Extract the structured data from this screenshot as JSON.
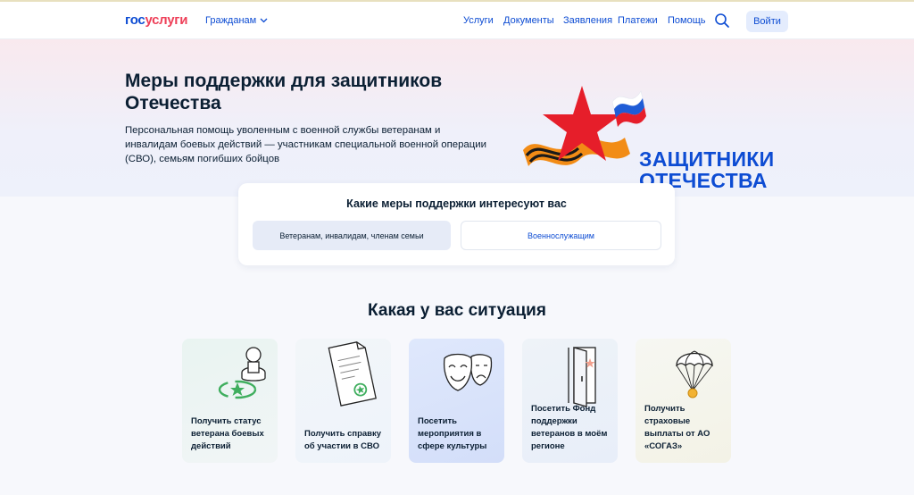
{
  "header": {
    "logo_part1": "гос",
    "logo_part2": "услуги",
    "audience": "Гражданам",
    "nav": [
      "Услуги",
      "Документы",
      "Заявления",
      "Платежи",
      "Помощь"
    ],
    "search_icon": "search-icon",
    "login": "Войти"
  },
  "hero": {
    "title": "Меры поддержки для защитников Отечества",
    "description": "Персональная помощь уволенным с военной службы ветеранам и инвалидам боевых действий — участникам специальной военной операции (СВО), семьям погибших бойцов",
    "logo_line1": "ЗАЩИТНИКИ",
    "logo_line2": "ОТЕЧЕСТВА"
  },
  "support": {
    "title": "Какие меры поддержки интересуют вас",
    "options": [
      "Ветеранам, инвалидам, членам семьи",
      "Военнослужащим"
    ]
  },
  "situations": {
    "title": "Какая у вас ситуация",
    "cards": [
      {
        "label": "Получить статус ветерана боевых действий",
        "icon": "stamp-icon"
      },
      {
        "label": "Получить справку об участии в СВО",
        "icon": "document-icon"
      },
      {
        "label": "Посетить мероприятия в сфере культуры",
        "icon": "theatre-masks-icon"
      },
      {
        "label": "Посетить Фонд поддержки ветеранов в моём регионе",
        "icon": "door-icon"
      },
      {
        "label": "Получить страховые выплаты от АО «СОГАЗ»",
        "icon": "parachute-icon"
      }
    ]
  },
  "colors": {
    "accent": "#0d4cd3",
    "logo_red": "#ee3f58",
    "text": "#0b1f33"
  }
}
